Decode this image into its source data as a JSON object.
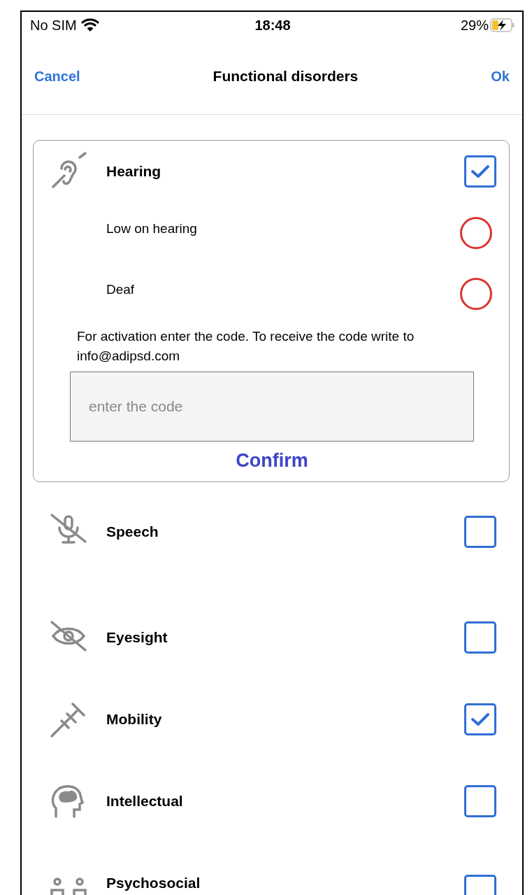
{
  "status_bar": {
    "carrier": "No SIM",
    "time": "18:48",
    "battery": "29%"
  },
  "nav": {
    "cancel": "Cancel",
    "title": "Functional disorders",
    "ok": "Ok"
  },
  "disorders": [
    {
      "label": "Hearing",
      "checked": true,
      "expanded": true,
      "options": [
        {
          "label": "Low on hearing",
          "selected": false
        },
        {
          "label": "Deaf",
          "selected": false
        }
      ],
      "activation": {
        "text": "For activation enter the code. To receive the code write to info@adipsd.com",
        "placeholder": "enter the code",
        "confirm": "Confirm"
      }
    },
    {
      "label": "Speech",
      "checked": false,
      "expanded": false
    },
    {
      "label": "Eyesight",
      "checked": false,
      "expanded": false
    },
    {
      "label": "Mobility",
      "checked": true,
      "expanded": false
    },
    {
      "label": "Intellectual",
      "checked": false,
      "expanded": false
    },
    {
      "label": "Psychosocial",
      "checked": false,
      "expanded": false
    }
  ]
}
